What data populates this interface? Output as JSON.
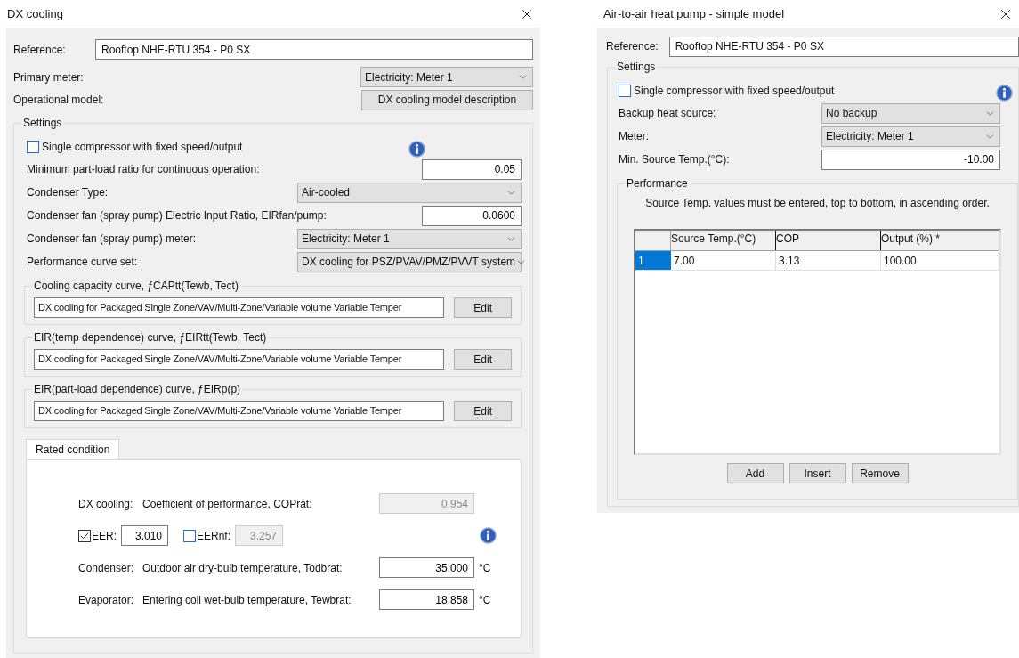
{
  "dx_cooling": {
    "title": "DX cooling",
    "reference": {
      "label": "Reference:",
      "value": "Rooftop NHE-RTU 354 - P0 SX"
    },
    "primary_meter": {
      "label": "Primary meter:",
      "value": "Electricity: Meter 1"
    },
    "operational_model": {
      "label": "Operational model:",
      "button": "DX cooling model description"
    },
    "settings": {
      "title": "Settings",
      "single_compressor": {
        "label": "Single compressor with fixed speed/output",
        "checked": false
      },
      "rows": [
        {
          "kind": "field",
          "label": "Minimum part-load ratio for continuous operation:",
          "value": "0.05"
        },
        {
          "kind": "dropdown",
          "label": "Condenser Type:",
          "value": "Air-cooled"
        },
        {
          "kind": "field",
          "label": "Condenser fan (spray pump) Electric Input Ratio, EIRfan/pump:",
          "value": "0.0600"
        },
        {
          "kind": "dropdown",
          "label": "Condenser fan (spray pump) meter:",
          "value": "Electricity: Meter 1"
        },
        {
          "kind": "dropdown",
          "label": "Performance curve set:",
          "value": "DX cooling for PSZ/PVAV/PMZ/PVVT system"
        }
      ],
      "curves": [
        {
          "title": "Cooling capacity curve, ƒCAPtt(Tewb, Tect)",
          "value": "DX cooling for Packaged Single Zone/VAV/Multi-Zone/Variable volume Variable Temper",
          "button": "Edit"
        },
        {
          "title": "EIR(temp dependence) curve, ƒEIRtt(Tewb, Tect)",
          "value": "DX cooling for Packaged Single Zone/VAV/Multi-Zone/Variable volume Variable Temper",
          "button": "Edit"
        },
        {
          "title": "EIR(part-load dependence) curve, ƒEIRp(p)",
          "value": "DX cooling for Packaged Single Zone/VAV/Multi-Zone/Variable volume Variable Temper",
          "button": "Edit"
        }
      ],
      "tabs": [
        {
          "label": "Rated condition",
          "selected": true
        }
      ],
      "rated": {
        "cop": {
          "group": "DX cooling:",
          "label": "Coefficient of performance, COPrat:",
          "value": "0.954",
          "disabled": true
        },
        "eer": {
          "label": "EER:",
          "checked": true,
          "value": "3.010"
        },
        "eernf": {
          "label": "EERnf:",
          "checked": false,
          "value": "3.257"
        },
        "temps": [
          {
            "group": "Condenser:",
            "label": "Outdoor air dry-bulb temperature, Todbrat:",
            "value": "35.000",
            "unit": "°C"
          },
          {
            "group": "Evaporator:",
            "label": "Entering coil wet-bulb temperature, Tewbrat:",
            "value": "18.858",
            "unit": "°C"
          }
        ]
      }
    }
  },
  "heat_pump": {
    "title": "Air-to-air heat pump - simple model",
    "reference": {
      "label": "Reference:",
      "value": "Rooftop NHE-RTU 354 - P0 SX"
    },
    "settings": {
      "title": "Settings",
      "single_compressor": {
        "label": "Single compressor with fixed speed/output",
        "checked": false
      },
      "rows": [
        {
          "kind": "dropdown",
          "label": "Backup heat source:",
          "value": "No backup"
        },
        {
          "kind": "dropdown",
          "label": "Meter:",
          "value": "Electricity: Meter 1"
        },
        {
          "kind": "field",
          "label": "Min. Source Temp.(°C):",
          "value": "-10.00"
        }
      ],
      "performance": {
        "title": "Performance",
        "note": "Source Temp. values must be entered, top to bottom, in ascending order.",
        "columns": [
          "Source Temp.(°C)",
          "COP",
          "Output (%) *"
        ],
        "rows": [
          {
            "index": "1",
            "selected": true,
            "cells": [
              "7.00",
              "3.13",
              "100.00"
            ]
          }
        ],
        "buttons": [
          "Add",
          "Insert",
          "Remove"
        ]
      }
    }
  }
}
